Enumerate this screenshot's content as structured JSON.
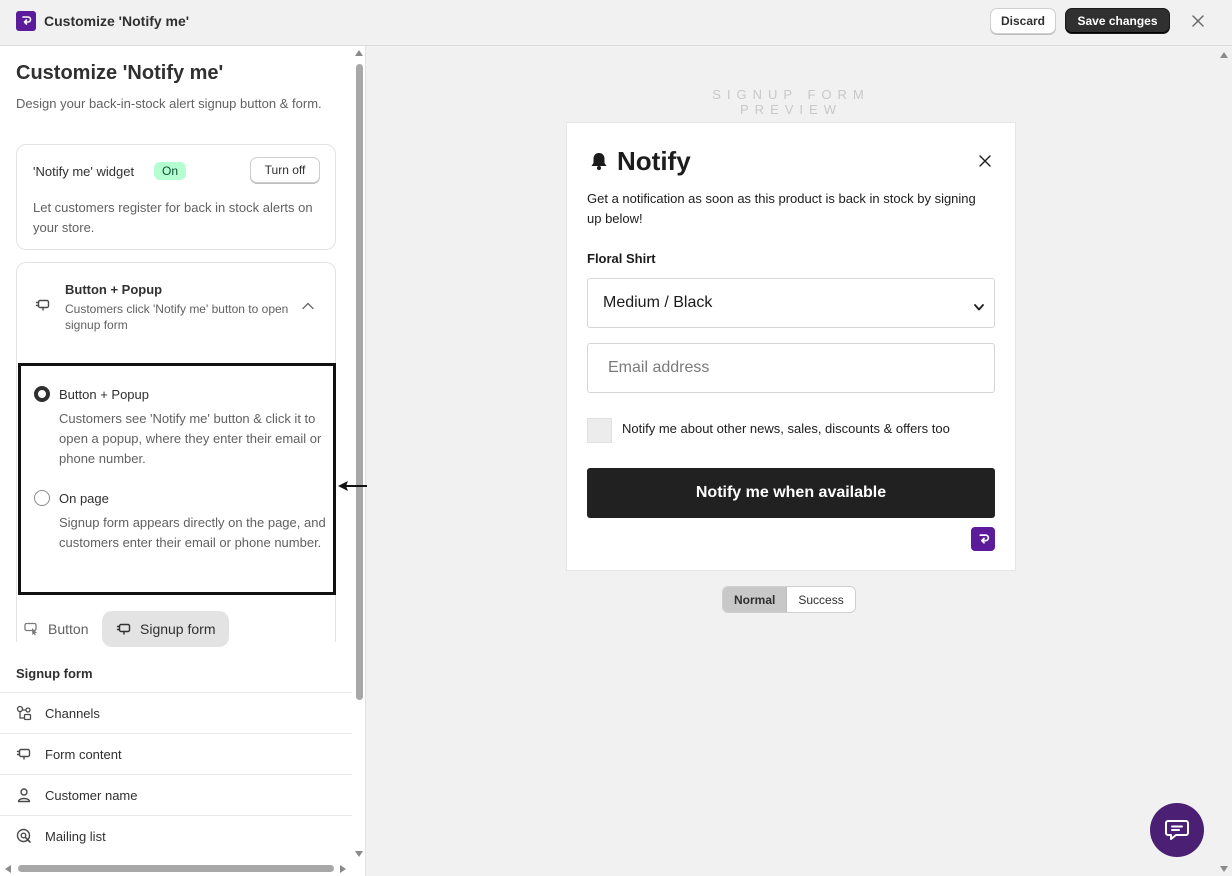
{
  "topbar": {
    "title": "Customize 'Notify me'",
    "discard_label": "Discard",
    "save_label": "Save changes"
  },
  "left": {
    "title": "Customize 'Notify me'",
    "subtitle": "Design your back-in-stock alert signup button & form.",
    "widget": {
      "label": "'Notify me' widget",
      "status": "On",
      "toggle_label": "Turn off",
      "description": "Let customers register for back in stock alerts on your store."
    },
    "mode": {
      "title": "Button + Popup",
      "subtitle": "Customers click 'Notify me' button to open signup form",
      "options": [
        {
          "title": "Button + Popup",
          "description": "Customers see 'Notify me' button & click it to open a popup, where they enter their email or phone number.",
          "selected": true
        },
        {
          "title": "On page",
          "description": "Signup form appears directly on the page, and customers enter their email or phone number.",
          "selected": false
        }
      ]
    },
    "tabs": [
      {
        "label": "Button",
        "active": false
      },
      {
        "label": "Signup form",
        "active": true
      }
    ],
    "section_label": "Signup form",
    "menu": [
      {
        "label": "Channels",
        "icon": "channels-icon"
      },
      {
        "label": "Form content",
        "icon": "form-content-icon"
      },
      {
        "label": "Customer name",
        "icon": "person-icon"
      },
      {
        "label": "Mailing list",
        "icon": "mailing-list-icon"
      }
    ]
  },
  "preview": {
    "label": "SIGNUP FORM PREVIEW",
    "popup": {
      "title": "Notify",
      "description": "Get a notification as soon as this product is back in stock by signing up below!",
      "product_name": "Floral Shirt",
      "variant": "Medium / Black",
      "email_placeholder": "Email address",
      "optin_label": "Notify me about other news, sales, discounts & offers too",
      "submit_label": "Notify me when available"
    },
    "states": [
      {
        "label": "Normal",
        "active": true
      },
      {
        "label": "Success",
        "active": false
      }
    ]
  },
  "colors": {
    "brand": "#5b1b9a",
    "primary_button": "#303030",
    "badge_on_bg": "#b4fed2",
    "chat_fab": "#4a1f74"
  }
}
